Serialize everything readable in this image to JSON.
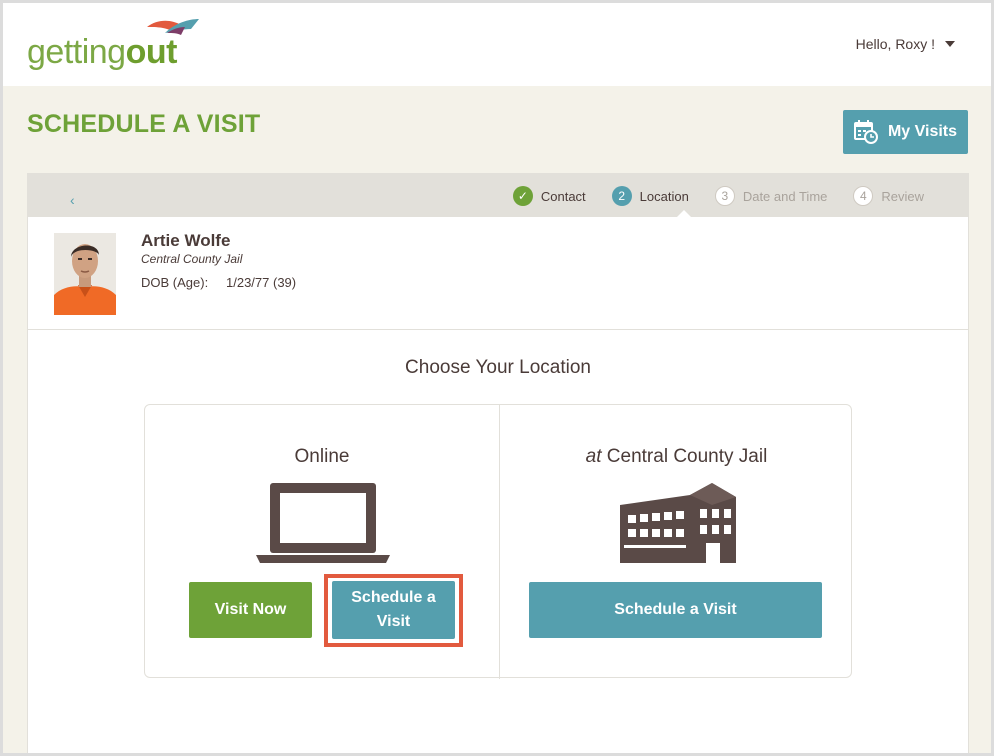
{
  "brand": {
    "logo_text_light": "getting",
    "logo_text_bold": "out",
    "green": "#6ea238",
    "teal": "#559fae",
    "orange": "#e25a3e"
  },
  "header": {
    "greeting": "Hello, Roxy !"
  },
  "page": {
    "title": "SCHEDULE A VISIT",
    "my_visits_label": "My Visits",
    "my_visits_icon": "calendar-clock-icon"
  },
  "steps": {
    "back_label": "‹",
    "items": [
      {
        "number": "✓",
        "label": "Contact",
        "state": "done"
      },
      {
        "number": "2",
        "label": "Location",
        "state": "active"
      },
      {
        "number": "3",
        "label": "Date and Time",
        "state": "todo"
      },
      {
        "number": "4",
        "label": "Review",
        "state": "todo"
      }
    ]
  },
  "inmate": {
    "name": "Artie Wolfe",
    "facility": "Central County Jail",
    "dob_label": "DOB (Age):",
    "dob_value": "1/23/77 (39)"
  },
  "location": {
    "heading": "Choose Your Location",
    "online": {
      "title": "Online",
      "icon": "laptop-icon",
      "visit_now_label": "Visit Now",
      "schedule_label": "Schedule a Visit"
    },
    "jail": {
      "title_prefix": "at",
      "title_name": "Central County Jail",
      "icon": "building-icon",
      "schedule_label": "Schedule a Visit"
    }
  }
}
